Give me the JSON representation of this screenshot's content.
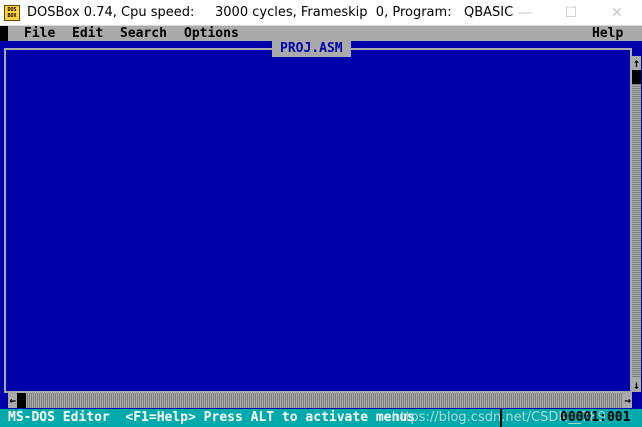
{
  "window": {
    "title": "DOSBox 0.74, Cpu speed:     3000 cycles, Frameskip  0, Program:   QBASIC",
    "icon_text": "DOS BOX",
    "controls": {
      "minimize": "—",
      "maximize": "☐",
      "close": "✕"
    }
  },
  "menu": {
    "items": [
      "File",
      "Edit",
      "Search",
      "Options"
    ],
    "help": "Help"
  },
  "editor": {
    "document_title": "PROJ.ASM"
  },
  "scrollbars": {
    "up_arrow": "↑",
    "down_arrow": "↓",
    "left_arrow": "←",
    "right_arrow": "→"
  },
  "status": {
    "text": "MS-DOS Editor  <F1=Help> Press ALT to activate menus",
    "position": "00001:001"
  },
  "watermark": "https://blog.csdn.net/CSDN__789",
  "colors": {
    "dos_blue": "#0000aa",
    "dos_gray": "#aaaaaa",
    "dos_cyan": "#00aaaa"
  }
}
